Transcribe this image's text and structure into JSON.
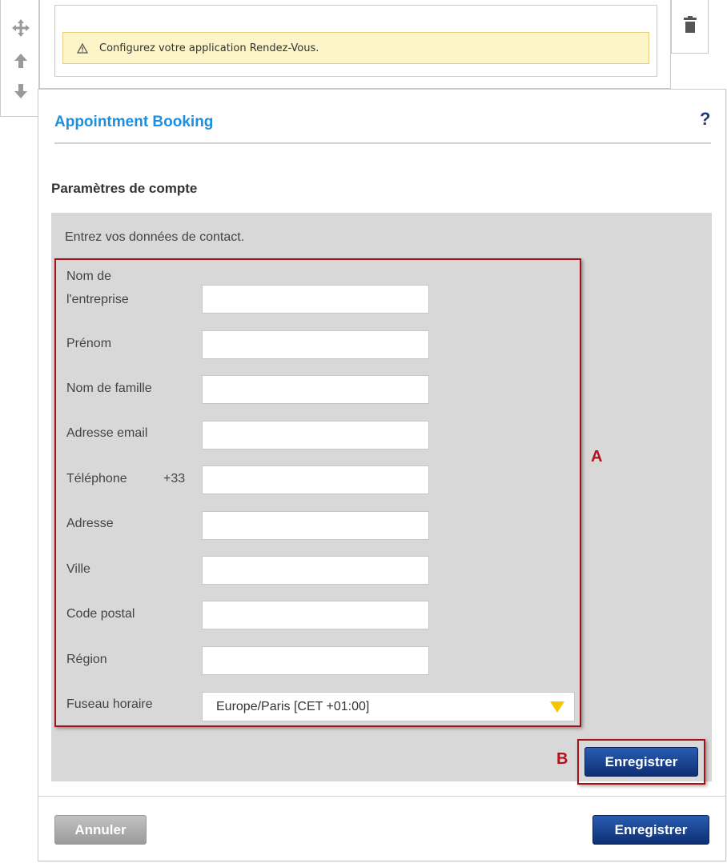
{
  "toolbar": {
    "move_icon": "move-icon",
    "up_icon": "arrow-up-icon",
    "down_icon": "arrow-down-icon",
    "delete_icon": "trash-icon"
  },
  "notice": {
    "icon": "warning-icon",
    "text": "Configurez votre application Rendez-Vous."
  },
  "panel": {
    "title": "Appointment Booking",
    "help": "?",
    "section_title": "Paramètres de compte",
    "intro": "Entrez vos données de contact."
  },
  "form": {
    "company_label_line1": "Nom de",
    "company_label_line2": "l'entreprise",
    "first_name_label": "Prénom",
    "last_name_label": "Nom de famille",
    "email_label": "Adresse email",
    "phone_label": "Téléphone",
    "phone_prefix": "+33",
    "address_label": "Adresse",
    "city_label": "Ville",
    "postal_code_label": "Code postal",
    "region_label": "Région",
    "timezone_label": "Fuseau horaire",
    "timezone_value": "Europe/Paris [CET +01:00]"
  },
  "annotations": {
    "a": "A",
    "b": "B"
  },
  "buttons": {
    "save_inline": "Enregistrer",
    "cancel": "Annuler",
    "save_footer": "Enregistrer"
  },
  "colors": {
    "title_blue": "#1c8fe0",
    "button_blue": "#0e2f74",
    "annotation_red": "#a3111b",
    "notice_yellow": "#fdf4c8"
  }
}
